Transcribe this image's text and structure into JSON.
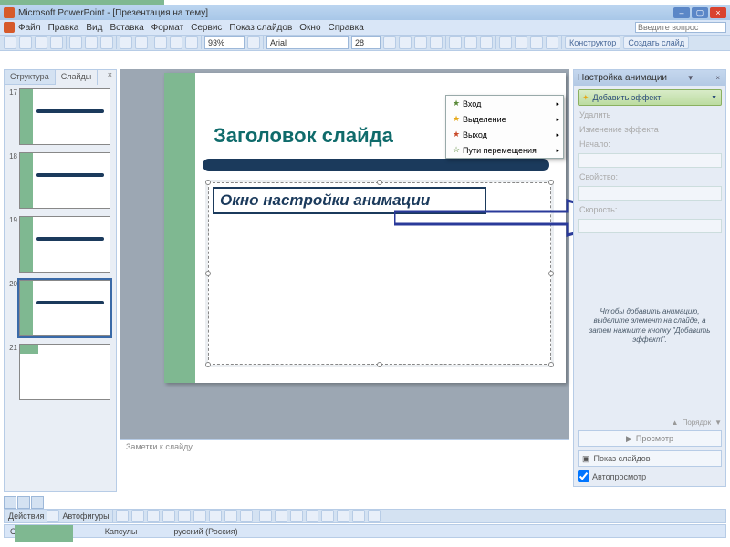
{
  "titlebar": {
    "title": "Microsoft PowerPoint - [Презентация на тему]"
  },
  "menu": {
    "file": "Файл",
    "edit": "Правка",
    "view": "Вид",
    "insert": "Вставка",
    "format": "Формат",
    "tools": "Сервис",
    "slideshow": "Показ слайдов",
    "window": "Окно",
    "help": "Справка",
    "question_placeholder": "Введите вопрос"
  },
  "toolbar": {
    "zoom": "93%",
    "font": "Arial",
    "size": "28",
    "designer": "Конструктор",
    "new_slide": "Создать слайд"
  },
  "left_tabs": {
    "outline": "Структура",
    "slides": "Слайды"
  },
  "thumbs": [
    {
      "num": "17"
    },
    {
      "num": "18"
    },
    {
      "num": "19"
    },
    {
      "num": "20"
    },
    {
      "num": "21"
    }
  ],
  "slide": {
    "title": "Заголовок слайда",
    "body_label": "Окно настройки анимации"
  },
  "notes": {
    "placeholder": "Заметки к слайду"
  },
  "popup": {
    "entrance": "Вход",
    "emphasis": "Выделение",
    "exit": "Выход",
    "motion": "Пути перемещения"
  },
  "taskpane": {
    "title": "Настройка анимации",
    "add_effect": "Добавить эффект",
    "remove": "Удалить",
    "change_effect": "Изменение эффекта",
    "start_label": "Начало:",
    "property_label": "Свойство:",
    "speed_label": "Скорость:",
    "hint": "Чтобы добавить анимацию, выделите элемент на слайде, а затем нажмите кнопку \"Добавить эффект\".",
    "order": "Порядок",
    "play": "Просмотр",
    "slideshow": "Показ слайдов",
    "autopreview": "Автопросмотр"
  },
  "drawbar": {
    "actions": "Действия",
    "autoshapes": "Автофигуры"
  },
  "status": {
    "slide": "Слайд 20 из 21",
    "theme": "Капсулы",
    "lang": "русский (Россия)"
  }
}
